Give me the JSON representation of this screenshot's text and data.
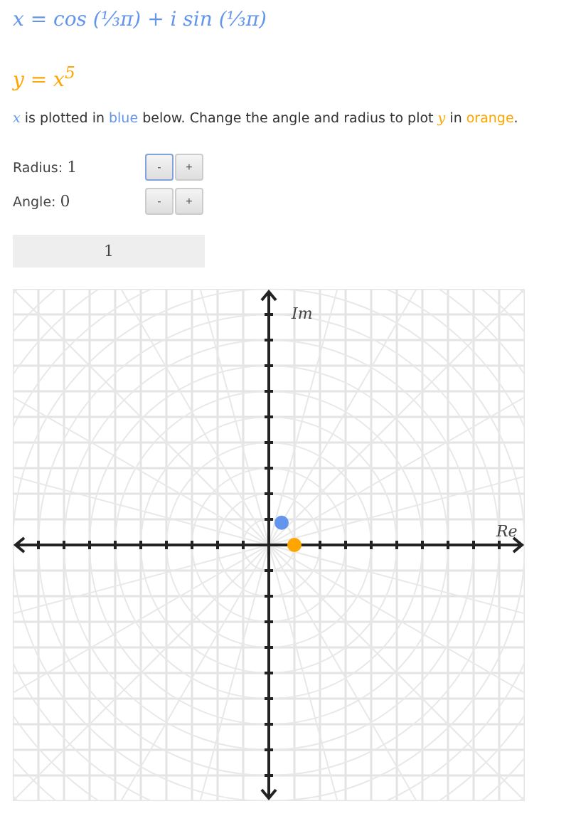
{
  "equations": [
    {
      "text": "x = cos (⅓π) + i sin (⅓π)",
      "color": "#6495ed"
    },
    {
      "text": "y = x$^{5}$",
      "color": "#ffa500"
    }
  ],
  "instruction": [
    {
      "text": "x",
      "color": "#6495ed",
      "math": true
    },
    {
      "text": " is plotted in ",
      "math": false
    },
    {
      "text": "blue",
      "color": "#6495ed",
      "math": false
    },
    {
      "text": " below. Change the angle and radius to plot ",
      "math": false
    },
    {
      "text": "y",
      "color": "#ffa500",
      "math": true
    },
    {
      "text": " in ",
      "math": false
    },
    {
      "text": "orange",
      "color": "#ffa500",
      "math": false
    },
    {
      "text": ".",
      "math": false
    }
  ],
  "controls": [
    {
      "label": "Radius:",
      "value": "1",
      "buttons": [
        {
          "text": "-",
          "focused": true
        },
        {
          "text": "+",
          "focused": false
        }
      ]
    },
    {
      "label": "Angle:",
      "value": "0",
      "buttons": [
        {
          "text": "-",
          "focused": false
        },
        {
          "text": "+",
          "focused": false
        }
      ]
    }
  ],
  "output": "1",
  "plot": {
    "real_label": "Re",
    "imag_label": "Im"
  }
}
